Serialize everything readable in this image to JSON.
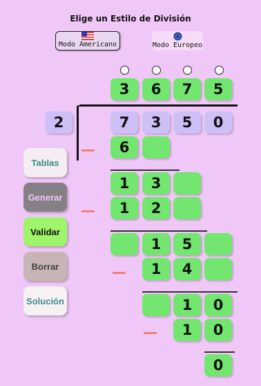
{
  "header": {
    "title": "Elige un Estilo de División"
  },
  "modes": {
    "american_label": "Modo Americano",
    "european_label": "Modo Europeo"
  },
  "buttons": {
    "tables": "Tablas",
    "generate": "Generar",
    "validate": "Validar",
    "clear": "Borrar",
    "solution": "Solución"
  },
  "colors": {
    "background": "#f0c8f8",
    "cell_green": "#73e66f",
    "cell_purple": "#cdc0f7",
    "minus_sign": "#f47d74"
  },
  "division": {
    "divisor": "2",
    "dividend": [
      "7",
      "3",
      "5",
      "0"
    ],
    "quotient": [
      "3",
      "6",
      "7",
      "5"
    ],
    "rows": {
      "r1": [
        "6",
        "–"
      ],
      "r2": [
        "1",
        "3",
        "–"
      ],
      "r3": [
        "1",
        "2",
        "–"
      ],
      "r4": [
        "–",
        "1",
        "5",
        "–"
      ],
      "r5": [
        "1",
        "4",
        "–"
      ],
      "r6": [
        "–",
        "1",
        "0"
      ],
      "r7": [
        "1",
        "0"
      ],
      "r8": [
        "0"
      ]
    }
  }
}
